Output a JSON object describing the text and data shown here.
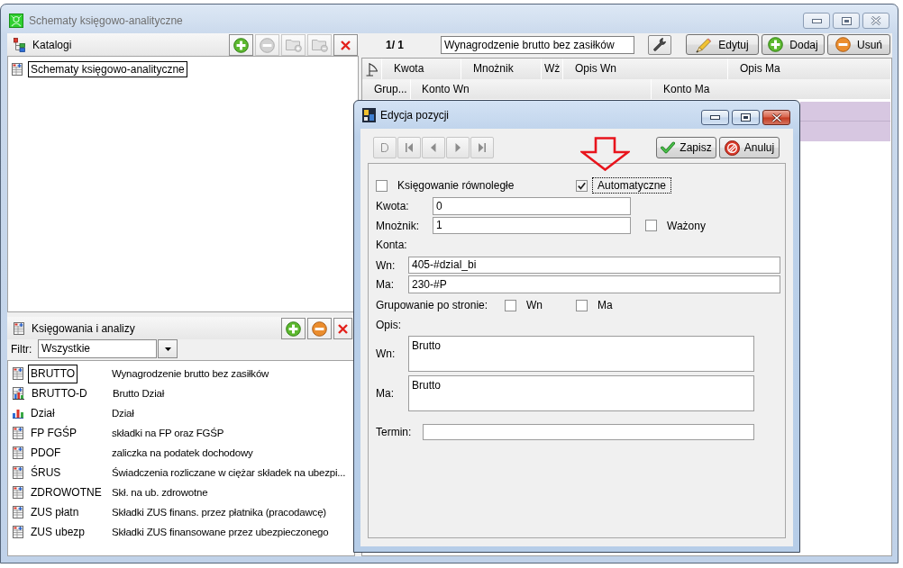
{
  "window": {
    "title": "Schematy księgowo-analityczne"
  },
  "catalogs_panel": {
    "title": "Katalogi",
    "toolbar": [
      {
        "kind": "add",
        "disabled": false
      },
      {
        "kind": "remove",
        "disabled": true
      },
      {
        "kind": "folder_add",
        "disabled": true
      },
      {
        "kind": "folder_remove",
        "disabled": true
      },
      {
        "kind": "delete",
        "disabled": false
      }
    ],
    "tree": [
      {
        "label": "Schematy księgowo-analityczne",
        "selected": true
      }
    ]
  },
  "postings_panel": {
    "title": "Księgowania i analizy",
    "toolbar": [
      {
        "kind": "add",
        "disabled": false
      },
      {
        "kind": "remove",
        "disabled": false
      },
      {
        "kind": "delete",
        "disabled": false
      }
    ],
    "filter": {
      "label": "Filtr:",
      "value": "Wszystkie"
    },
    "items": [
      {
        "kind": "table",
        "code": "BRUTTO",
        "description": "Wynagrodzenie brutto bez zasiłków",
        "selected": true
      },
      {
        "kind": "table_chart",
        "code": "BRUTTO-D",
        "description": "Brutto Dział",
        "selected": false
      },
      {
        "kind": "chart",
        "code": "Dział",
        "description": "Dział",
        "selected": false
      },
      {
        "kind": "table",
        "code": "FP FGŚP",
        "description": "składki na FP oraz FGŚP",
        "selected": false
      },
      {
        "kind": "table",
        "code": "PDOF",
        "description": "zaliczka na podatek dochodowy",
        "selected": false
      },
      {
        "kind": "table",
        "code": "ŚRUS",
        "description": "Świadczenia rozliczane w ciężar składek na ubezpi...",
        "selected": false
      },
      {
        "kind": "table",
        "code": "ZDROWOTNE",
        "description": "Skł. na ub. zdrowotne",
        "selected": false
      },
      {
        "kind": "table",
        "code": "ZUS płatn",
        "description": "Składki ZUS finans. przez płatnika (pracodawcę)",
        "selected": false
      },
      {
        "kind": "table",
        "code": "ZUS ubezp",
        "description": "Składki ZUS finansowane przez ubezpieczonego",
        "selected": false
      }
    ]
  },
  "record_bar": {
    "position": "1/ 1",
    "name": "Wynagrodzenie brutto bez zasiłków",
    "buttons": [
      {
        "kind": "edit",
        "label": "Edytuj"
      },
      {
        "kind": "add",
        "label": "Dodaj"
      },
      {
        "kind": "remove",
        "label": "Usuń"
      }
    ]
  },
  "grid": {
    "header_rows": [
      [
        {
          "label": "Kwota"
        },
        {
          "label": "Mnożnik"
        },
        {
          "label": "Wż"
        },
        {
          "label": "Opis Wn"
        },
        {
          "label": "Opis Ma"
        }
      ],
      [
        {
          "label": "Grup..."
        },
        {
          "label": "Konto Wn"
        },
        {
          "label": "Konto Ma"
        }
      ]
    ],
    "records": [
      {
        "selected": true
      }
    ]
  },
  "dialog": {
    "title": "Edycja pozycji",
    "navigation": [
      {
        "kind": "new",
        "disabled": true
      },
      {
        "kind": "first",
        "disabled": true
      },
      {
        "kind": "previous",
        "disabled": true
      },
      {
        "kind": "next",
        "disabled": true
      },
      {
        "kind": "last",
        "disabled": true
      }
    ],
    "actions": [
      {
        "kind": "save",
        "label": "Zapisz"
      },
      {
        "kind": "cancel",
        "label": "Anuluj"
      }
    ],
    "parallel_posting": {
      "label": "Księgowanie równoległe",
      "checked": false
    },
    "automatic": {
      "label": "Automatyczne",
      "checked": true,
      "focused": true
    },
    "amount": {
      "label": "Kwota:",
      "value": "0"
    },
    "multiplier": {
      "label": "Mnożnik:",
      "value": "1"
    },
    "weighted": {
      "label": "Ważony",
      "checked": false
    },
    "accounts": {
      "label": "Konta:",
      "debit": {
        "label": "Wn:",
        "value": "405-#dzial_bi"
      },
      "credit": {
        "label": "Ma:",
        "value": "230-#P"
      }
    },
    "grouping": {
      "label": "Grupowanie po stronie:",
      "options": [
        {
          "label": "Wn",
          "checked": false
        },
        {
          "label": "Ma",
          "checked": false
        }
      ]
    },
    "description": {
      "label": "Opis:",
      "debit": {
        "label": "Wn:",
        "value": "Brutto"
      },
      "credit": {
        "label": "Ma:",
        "value": "Brutto"
      }
    },
    "term": {
      "label": "Termin:"
    }
  }
}
